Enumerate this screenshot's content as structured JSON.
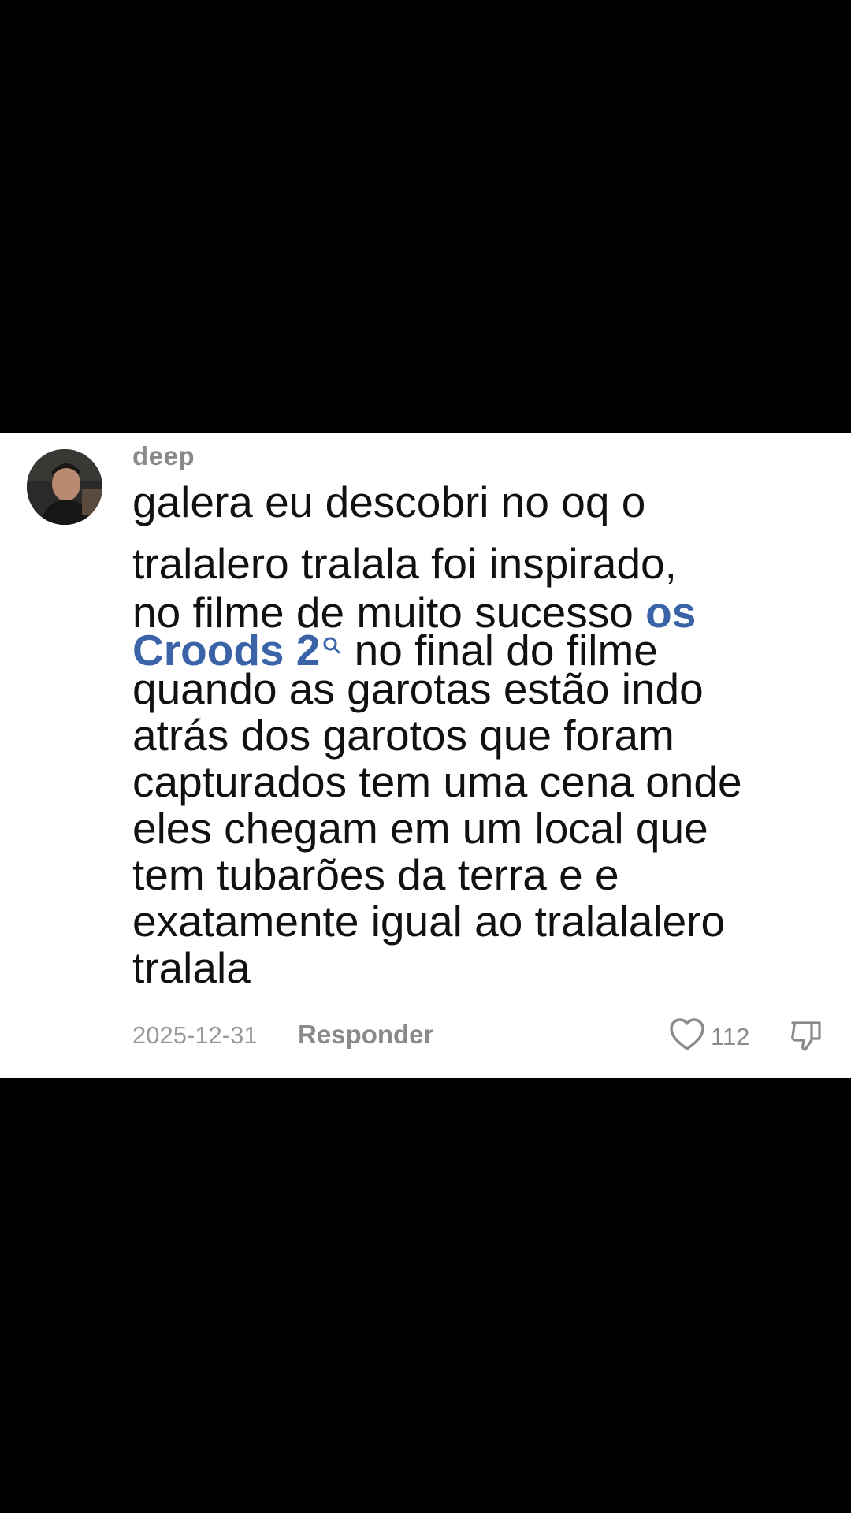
{
  "comment": {
    "username": "deep",
    "text_lines": [
      "galera eu descobri no oq o",
      "tralalero tralala foi inspirado,",
      "no filme de muito sucesso",
      "no final do filme",
      "quando as garotas estão indo",
      "atrás dos garotos que foram",
      "capturados tem uma cena onde",
      "eles chegam em um local que",
      "tem tubarões da terra e e",
      "exatamente igual ao tralalalero",
      "tralala"
    ],
    "link_part1": "os",
    "link_part2": "Croods 2",
    "date": "2025-12-31",
    "reply_label": "Responder",
    "like_count": "112"
  },
  "colors": {
    "background": "#000000",
    "card": "#ffffff",
    "text": "#111111",
    "muted": "#8a8a8a",
    "link": "#3b63a8"
  },
  "icons": {
    "like": "heart-outline-icon",
    "dislike": "thumbs-down-icon",
    "link_search": "search-icon"
  }
}
